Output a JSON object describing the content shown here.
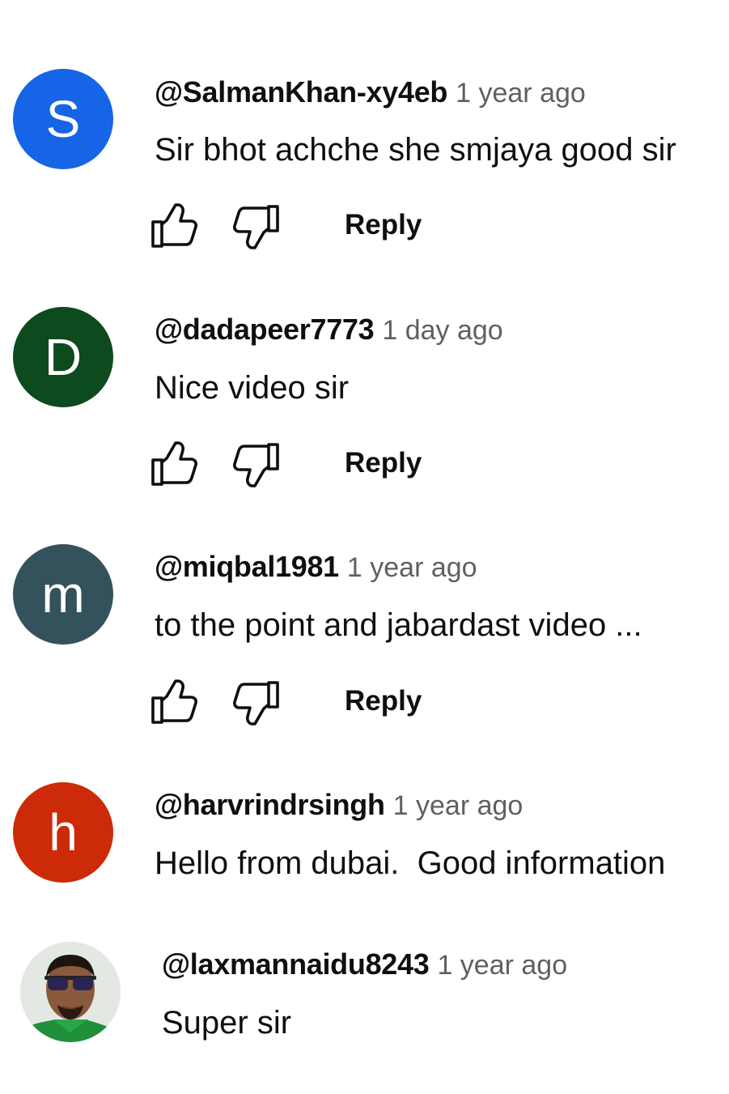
{
  "comments": [
    {
      "author": "@SalmanKhan-xy4eb",
      "time": "1 year ago",
      "text": "Sir bhot achche she smjaya good sir",
      "avatar_letter": "S",
      "avatar_color": "#1565e6",
      "reply_label": "Reply"
    },
    {
      "author": "@dadapeer7773",
      "time": "1 day ago",
      "text": "Nice video sir",
      "avatar_letter": "D",
      "avatar_color": "#0d4a1e",
      "reply_label": "Reply"
    },
    {
      "author": "@miqbal1981",
      "time": "1 year ago",
      "text": "to the point and jabardast video ...",
      "avatar_letter": "m",
      "avatar_color": "#34525c",
      "reply_label": "Reply"
    },
    {
      "author": "@harvrindrsingh",
      "time": "1 year ago",
      "text": "Hello from dubai.  Good information",
      "avatar_letter": "h",
      "avatar_color": "#cc2a08"
    },
    {
      "author": "@laxmannaidu8243",
      "time": "1 year ago",
      "text": "Super sir",
      "avatar_type": "photo"
    }
  ],
  "icons": {
    "like": "thumbs-up-icon",
    "dislike": "thumbs-down-icon"
  }
}
